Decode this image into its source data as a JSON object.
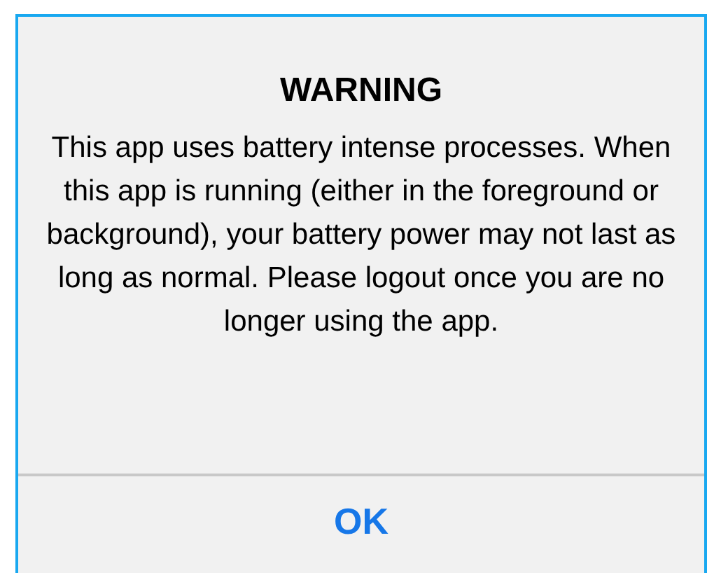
{
  "dialog": {
    "title": "WARNING",
    "message": "This app uses battery intense processes. When this app is running (either in the foreground or background), your battery power may not last as long as normal. Please logout once you are no longer using the app.",
    "buttons": [
      "OK"
    ]
  }
}
